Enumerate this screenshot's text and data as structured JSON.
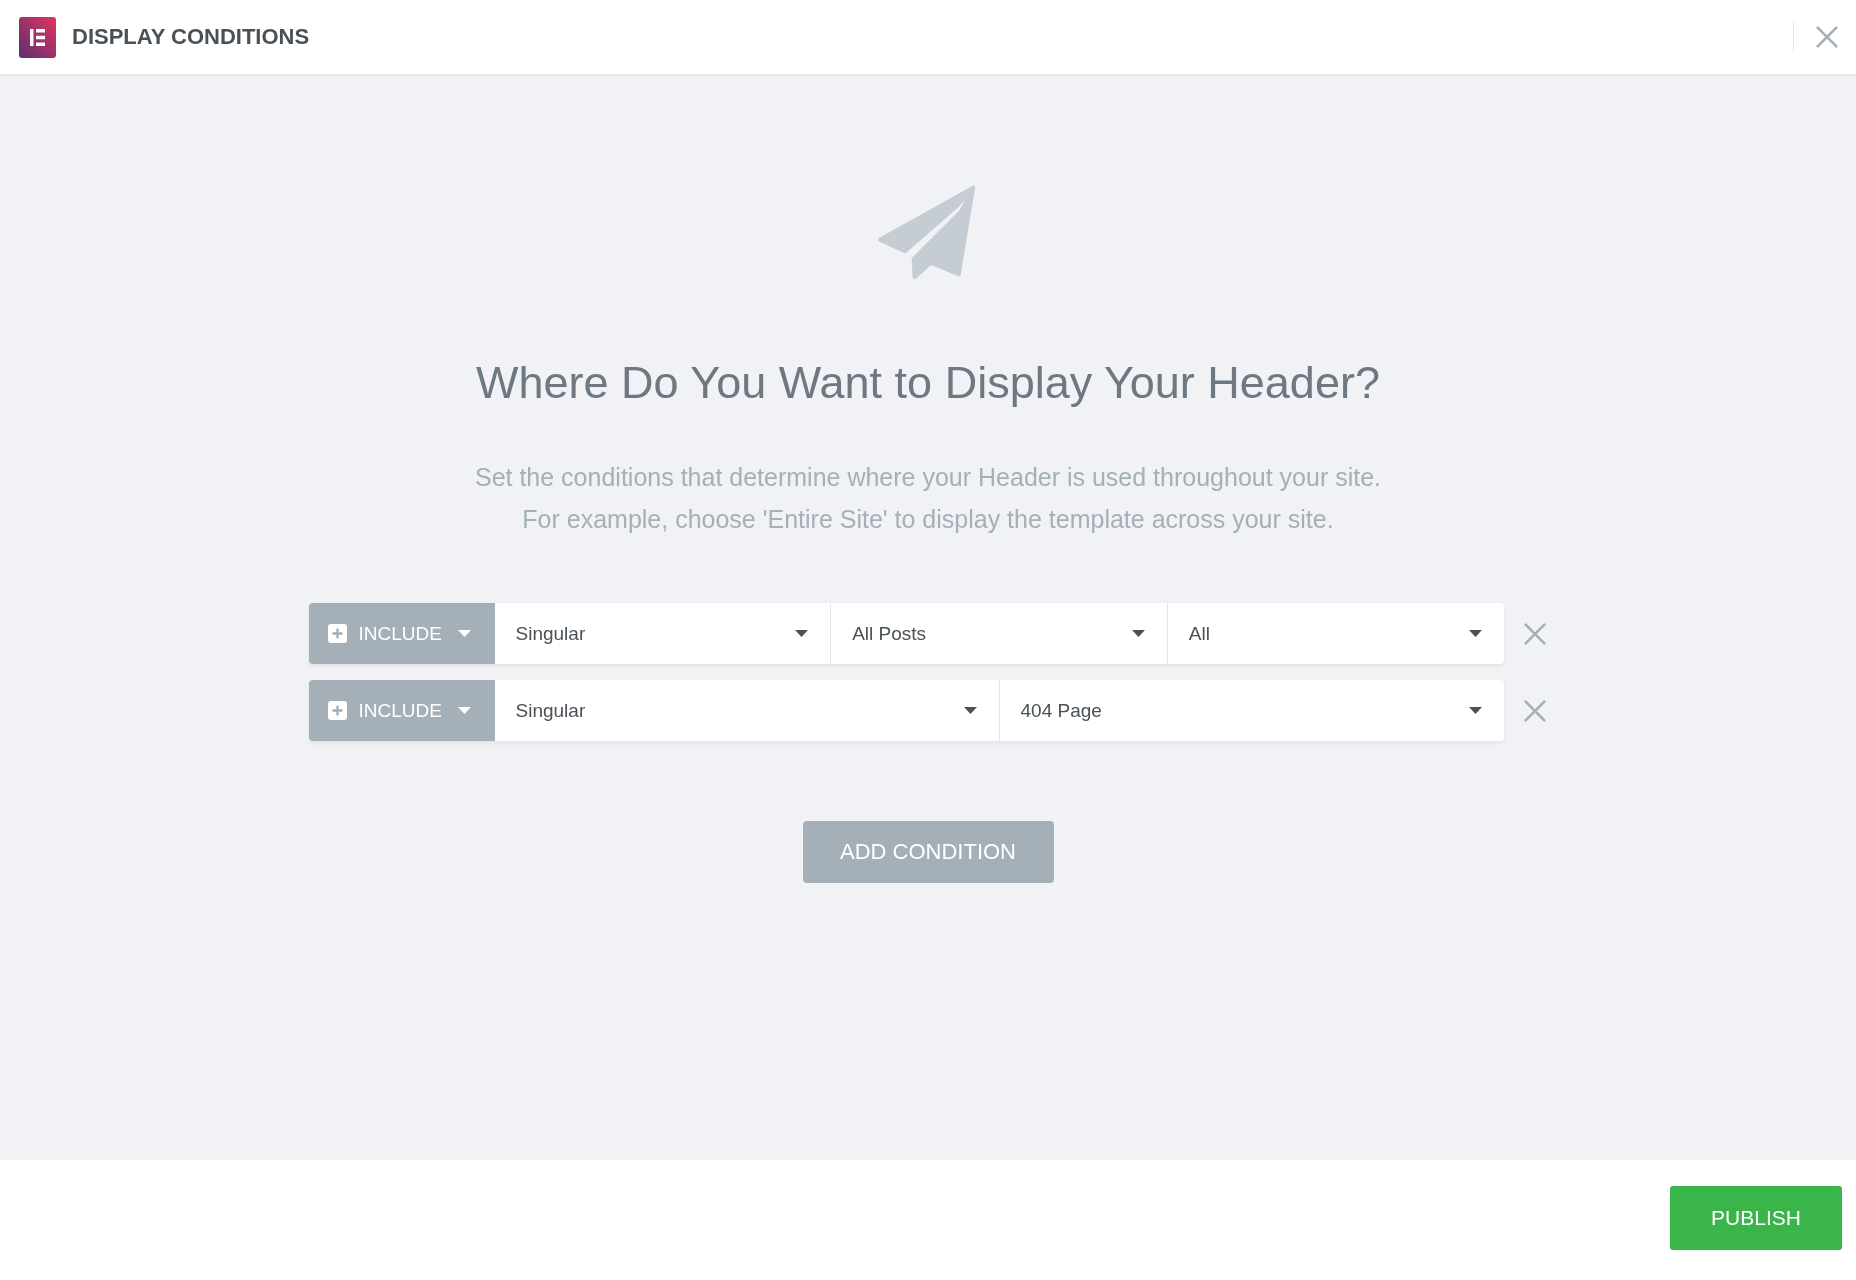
{
  "header": {
    "title": "DISPLAY CONDITIONS"
  },
  "intro": {
    "heading": "Where Do You Want to Display Your Header?",
    "description": [
      "Set the conditions that determine where your Header is used throughout your site.",
      "For example, choose 'Entire Site' to display the template across your site."
    ]
  },
  "conditions": [
    {
      "mode": "INCLUDE",
      "selects": [
        {
          "value": "Singular"
        },
        {
          "value": "All Posts"
        },
        {
          "value": "All"
        }
      ]
    },
    {
      "mode": "INCLUDE",
      "selects": [
        {
          "value": "Singular"
        },
        {
          "value": "404 Page"
        }
      ]
    }
  ],
  "add_button": "ADD CONDITION",
  "footer": {
    "publish_button": "PUBLISH"
  }
}
